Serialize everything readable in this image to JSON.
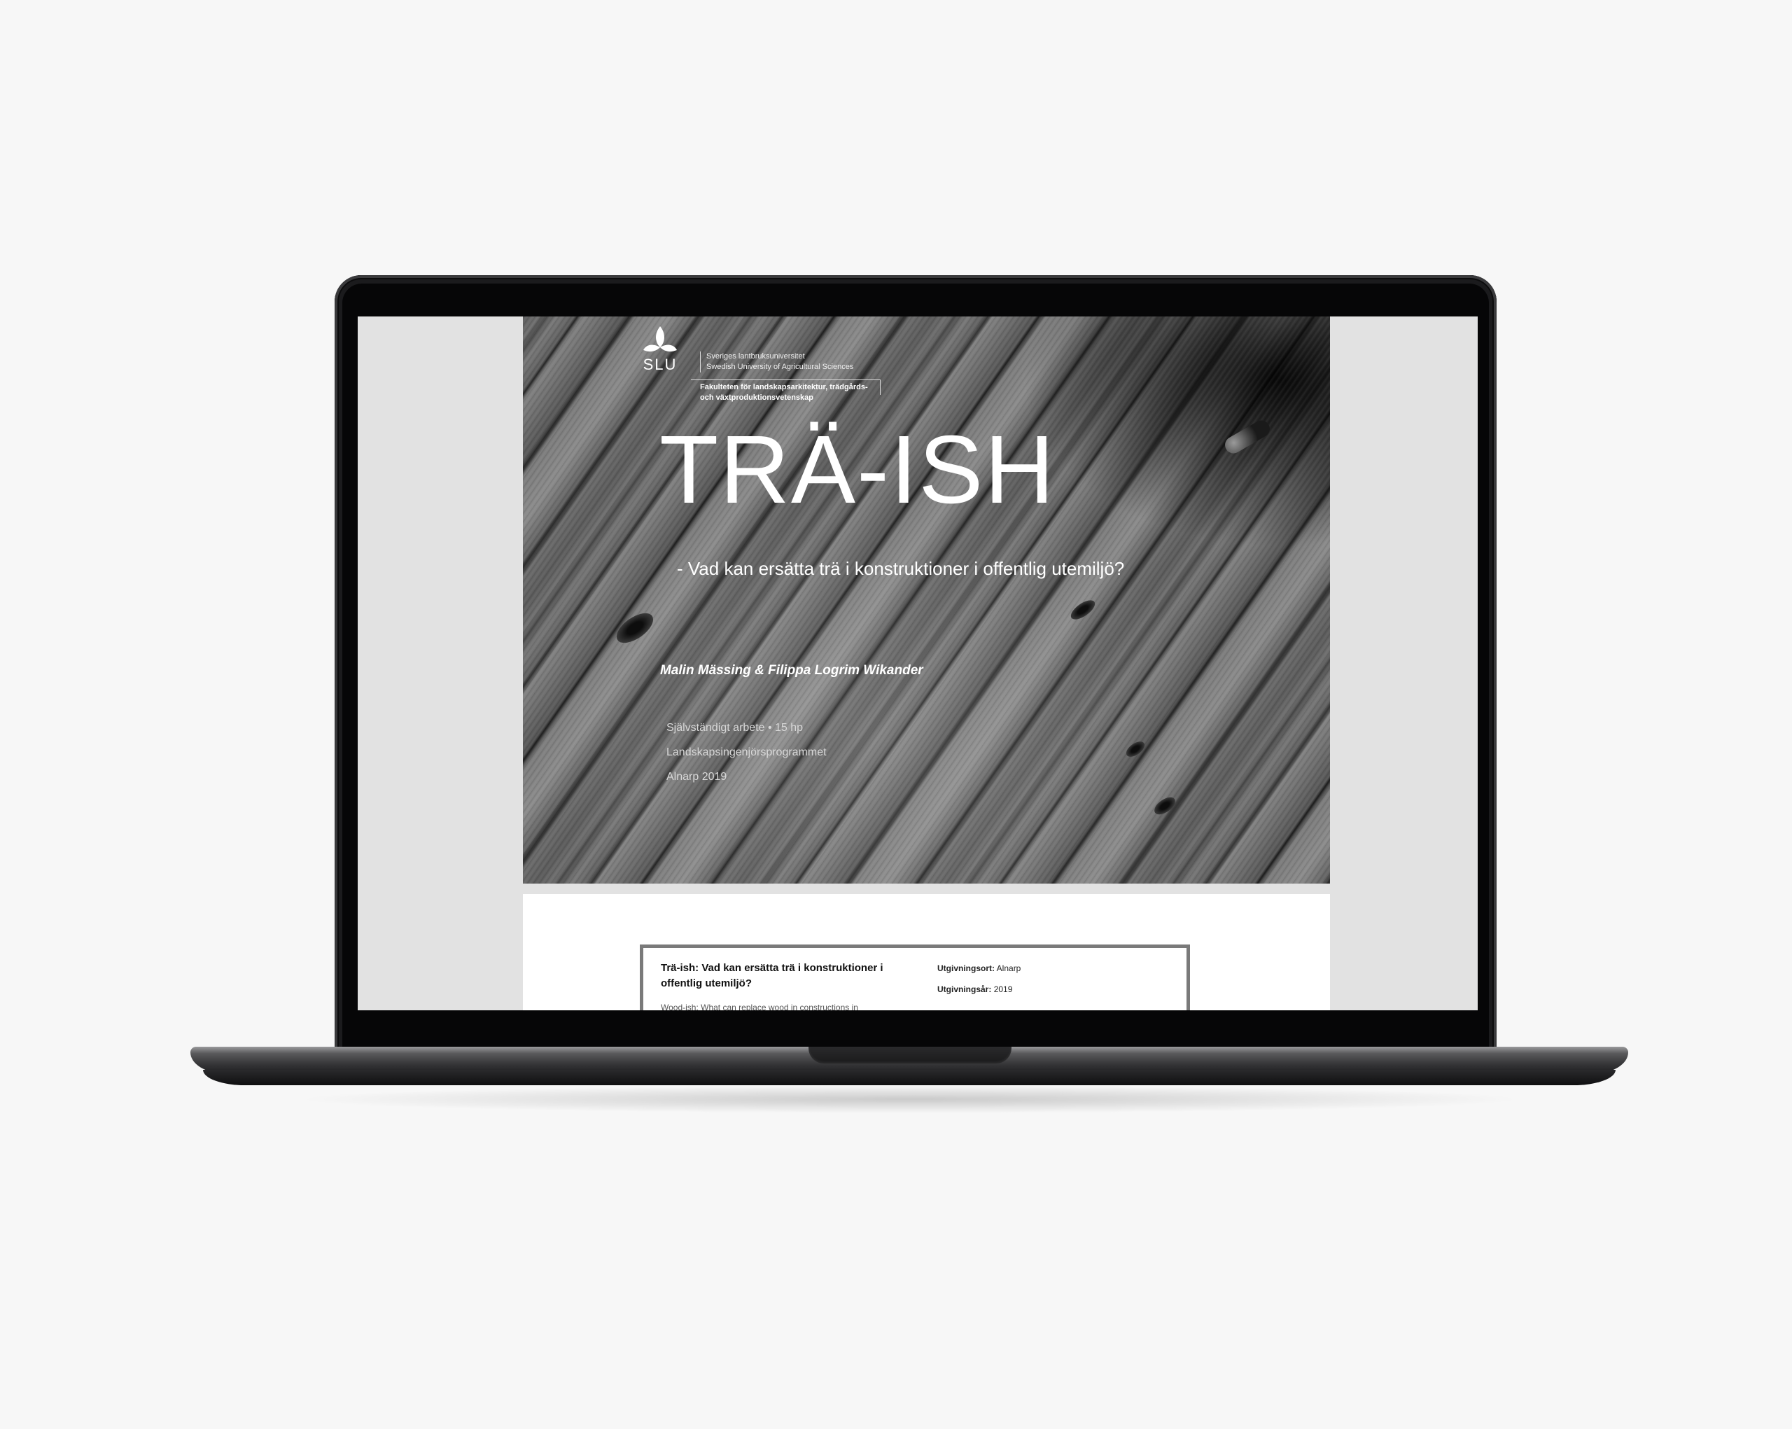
{
  "cover": {
    "logo_text": "SLU",
    "university_sv": "Sveriges lantbruksuniversitet",
    "university_en": "Swedish University of Agricultural Sciences",
    "faculty_line1": "Fakulteten för landskapsarkitektur, trädgårds-",
    "faculty_line2": "och växtproduktionsvetenskap",
    "title": "TRÄ-ISH",
    "subtitle": "-  Vad kan ersätta trä i konstruktioner i offentlig utemiljö?",
    "authors": "Malin Mässing & Filippa Logrim Wikander",
    "meta_line1": "Självständigt arbete • 15 hp",
    "meta_line2": "Landskapsingenjörsprogrammet",
    "meta_line3": "Alnarp 2019"
  },
  "info": {
    "title": "Trä-ish: Vad kan ersätta trä i konstruktioner i offentlig utemiljö?",
    "subtitle_partial": "Wood-ish: What can replace wood in constructions in",
    "place_label": "Utgivningsort:",
    "place_value": "Alnarp",
    "year_label": "Utgivningsår:",
    "year_value": "2019"
  }
}
